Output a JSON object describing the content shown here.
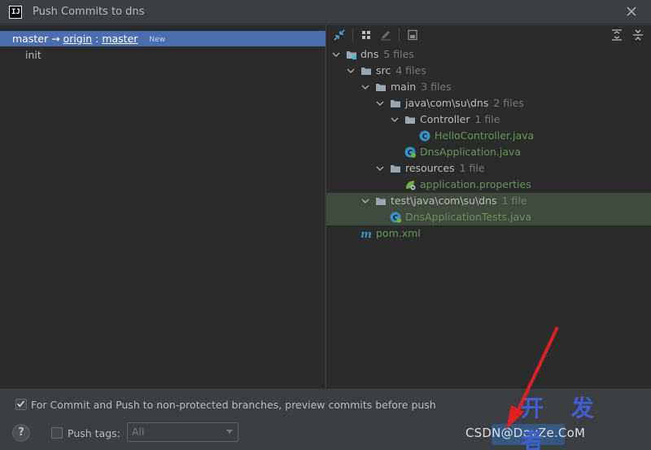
{
  "window": {
    "title": "Push Commits to dns"
  },
  "left": {
    "branch": {
      "local": "master",
      "arrow": "→",
      "remote": "origin",
      "sep": ":",
      "remote_branch": "master",
      "badge": "New"
    },
    "commits": [
      "init"
    ]
  },
  "tree": {
    "rows": [
      {
        "label": "dns",
        "count": "5 files"
      },
      {
        "label": "src",
        "count": "4 files"
      },
      {
        "label": "main",
        "count": "3 files"
      },
      {
        "label": "java\\com\\su\\dns",
        "count": "2 files"
      },
      {
        "label": "Controller",
        "count": "1 file"
      },
      {
        "label": "HelloController.java",
        "count": ""
      },
      {
        "label": "DnsApplication.java",
        "count": ""
      },
      {
        "label": "resources",
        "count": "1 file"
      },
      {
        "label": "application.properties",
        "count": ""
      },
      {
        "label": "test\\java\\com\\su\\dns",
        "count": "1 file"
      },
      {
        "label": "DnsApplicationTests.java",
        "count": ""
      },
      {
        "label": "pom.xml",
        "count": ""
      }
    ]
  },
  "bottom": {
    "preview_label": "For Commit and Push to non-protected branches, preview commits before push",
    "preview_checked": true,
    "push_tags_label": "Push tags:",
    "push_tags_checked": false,
    "tags_select_value": "All",
    "help": "?"
  },
  "watermark": {
    "small": "CSDN@",
    "big": "开 发 者",
    "site": "DevZe.CoM"
  },
  "colors": {
    "selection": "#4b6eaf",
    "added_file": "#629755",
    "push_button": "#365880"
  }
}
